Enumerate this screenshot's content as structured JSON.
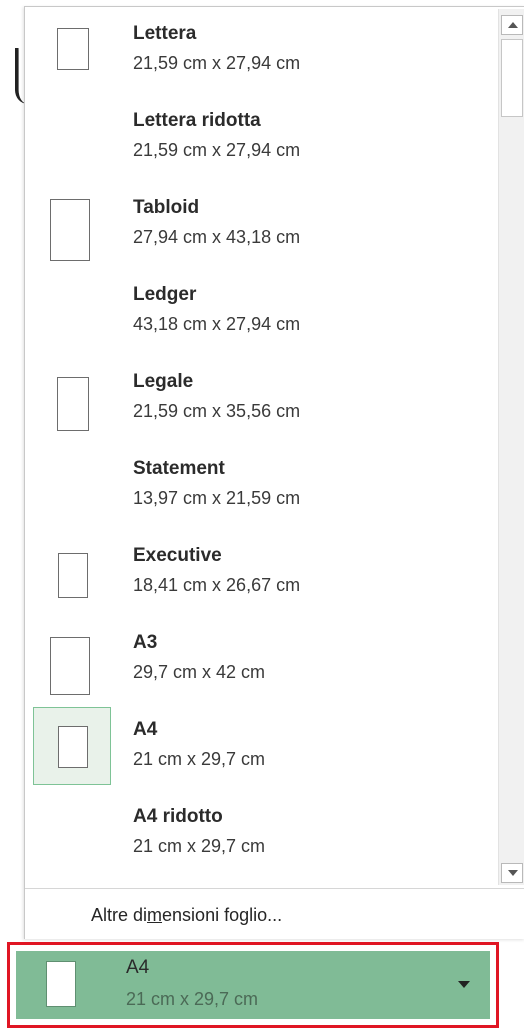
{
  "paper_sizes": [
    {
      "name": "Lettera",
      "dims": "21,59 cm x 27,94 cm",
      "thumb": true
    },
    {
      "name": "Lettera ridotta",
      "dims": "21,59 cm x 27,94 cm",
      "thumb": false
    },
    {
      "name": "Tabloid",
      "dims": "27,94 cm x 43,18 cm",
      "thumb": true
    },
    {
      "name": "Ledger",
      "dims": "43,18 cm x 27,94 cm",
      "thumb": false
    },
    {
      "name": "Legale",
      "dims": "21,59 cm x 35,56 cm",
      "thumb": true
    },
    {
      "name": "Statement",
      "dims": "13,97 cm x 21,59 cm",
      "thumb": false
    },
    {
      "name": "Executive",
      "dims": "18,41 cm x 26,67 cm",
      "thumb": true
    },
    {
      "name": "A3",
      "dims": "29,7 cm x 42 cm",
      "thumb": true
    },
    {
      "name": "A4",
      "dims": "21 cm x 29,7 cm",
      "thumb": true,
      "selected": true
    },
    {
      "name": "A4 ridotto",
      "dims": "21 cm x 29,7 cm",
      "thumb": false
    }
  ],
  "more_sizes": {
    "before": "Altre di",
    "underlined": "m",
    "after": "ensioni foglio..."
  },
  "current": {
    "name": "A4",
    "dims": "21 cm x 29,7 cm"
  },
  "colors": {
    "selected_bg": "#80bb96",
    "highlight_border": "#e01523",
    "selected_item_border": "#7ec396"
  }
}
